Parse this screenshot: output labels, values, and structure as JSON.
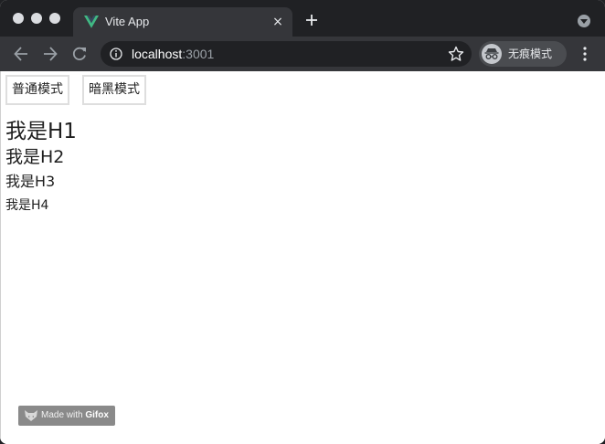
{
  "browser": {
    "tab": {
      "title": "Vite App",
      "close_glyph": "×",
      "favicon": "vue-logo-icon"
    },
    "new_tab_icon": "plus-icon",
    "tab_search_icon": "chevron-down-circle-icon",
    "toolbar": {
      "back_icon": "arrow-left-icon",
      "forward_icon": "arrow-right-icon",
      "reload_icon": "reload-icon",
      "address": {
        "security_icon": "info-icon",
        "host": "localhost",
        "port": ":3001",
        "bookmark_icon": "star-icon"
      },
      "incognito": {
        "icon": "incognito-icon",
        "label": "无痕模式"
      },
      "menu_icon": "kebab-menu-icon"
    }
  },
  "page": {
    "buttons": {
      "normal": "普通模式",
      "dark": "暗黑模式"
    },
    "headings": {
      "h1": "我是H1",
      "h2": "我是H2",
      "h3": "我是H3",
      "h4": "我是H4"
    },
    "watermark": {
      "icon": "gifox-fox-icon",
      "prefix": "Made with ",
      "brand": "Gifox"
    }
  },
  "colors": {
    "tabstrip_bg": "#202124",
    "toolbar_bg": "#35363a",
    "omnibox_bg": "#202124",
    "vue_green": "#41b883",
    "page_bg": "#ffffff",
    "button_border": "#dedede"
  }
}
